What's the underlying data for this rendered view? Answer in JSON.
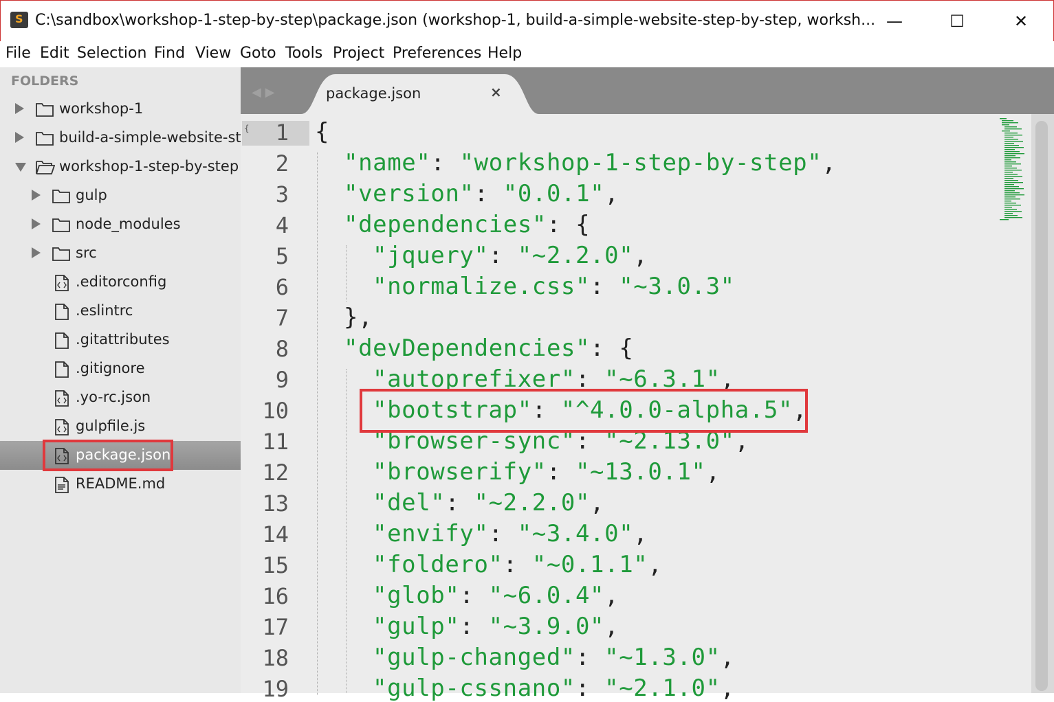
{
  "window": {
    "title": "C:\\sandbox\\workshop-1-step-by-step\\package.json (workshop-1, build-a-simple-website-step-by-step, worksh...",
    "minimize": "—",
    "maximize": "☐",
    "close": "✕"
  },
  "menu": [
    "File",
    "Edit",
    "Selection",
    "Find",
    "View",
    "Goto",
    "Tools",
    "Project",
    "Preferences",
    "Help"
  ],
  "sidebar": {
    "header": "FOLDERS",
    "items": [
      {
        "label": "workshop-1",
        "type": "folder",
        "depth": 0,
        "arrow": "closed"
      },
      {
        "label": "build-a-simple-website-ste",
        "type": "folder",
        "depth": 0,
        "arrow": "closed"
      },
      {
        "label": "workshop-1-step-by-step",
        "type": "folder-open",
        "depth": 0,
        "arrow": "open"
      },
      {
        "label": "gulp",
        "type": "folder",
        "depth": 1,
        "arrow": "closed"
      },
      {
        "label": "node_modules",
        "type": "folder",
        "depth": 1,
        "arrow": "closed"
      },
      {
        "label": "src",
        "type": "folder",
        "depth": 1,
        "arrow": "closed"
      },
      {
        "label": ".editorconfig",
        "type": "code-file",
        "depth": 1
      },
      {
        "label": ".eslintrc",
        "type": "file",
        "depth": 1
      },
      {
        "label": ".gitattributes",
        "type": "file",
        "depth": 1
      },
      {
        "label": ".gitignore",
        "type": "file",
        "depth": 1
      },
      {
        "label": ".yo-rc.json",
        "type": "code-file",
        "depth": 1
      },
      {
        "label": "gulpfile.js",
        "type": "code-file",
        "depth": 1
      },
      {
        "label": "package.json",
        "type": "code-file",
        "depth": 1,
        "selected": true
      },
      {
        "label": "README.md",
        "type": "text-file",
        "depth": 1
      }
    ]
  },
  "tab": {
    "label": "package.json",
    "close": "×"
  },
  "editor": {
    "lines": [
      {
        "n": "1",
        "indent": 0,
        "parts": [
          [
            "p",
            "{"
          ]
        ]
      },
      {
        "n": "2",
        "indent": 1,
        "parts": [
          [
            "s",
            "\"name\""
          ],
          [
            "p",
            ": "
          ],
          [
            "s",
            "\"workshop-1-step-by-step\""
          ],
          [
            "p",
            ","
          ]
        ]
      },
      {
        "n": "3",
        "indent": 1,
        "parts": [
          [
            "s",
            "\"version\""
          ],
          [
            "p",
            ": "
          ],
          [
            "s",
            "\"0.0.1\""
          ],
          [
            "p",
            ","
          ]
        ]
      },
      {
        "n": "4",
        "indent": 1,
        "parts": [
          [
            "s",
            "\"dependencies\""
          ],
          [
            "p",
            ": {"
          ]
        ]
      },
      {
        "n": "5",
        "indent": 2,
        "parts": [
          [
            "s",
            "\"jquery\""
          ],
          [
            "p",
            ": "
          ],
          [
            "s",
            "\"~2.2.0\""
          ],
          [
            "p",
            ","
          ]
        ]
      },
      {
        "n": "6",
        "indent": 2,
        "parts": [
          [
            "s",
            "\"normalize.css\""
          ],
          [
            "p",
            ": "
          ],
          [
            "s",
            "\"~3.0.3\""
          ]
        ]
      },
      {
        "n": "7",
        "indent": 1,
        "parts": [
          [
            "p",
            "},"
          ]
        ]
      },
      {
        "n": "8",
        "indent": 1,
        "parts": [
          [
            "s",
            "\"devDependencies\""
          ],
          [
            "p",
            ": {"
          ]
        ]
      },
      {
        "n": "9",
        "indent": 2,
        "parts": [
          [
            "s",
            "\"autoprefixer\""
          ],
          [
            "p",
            ": "
          ],
          [
            "s",
            "\"~6.3.1\""
          ],
          [
            "p",
            ","
          ]
        ]
      },
      {
        "n": "10",
        "indent": 2,
        "parts": [
          [
            "s",
            "\"bootstrap\""
          ],
          [
            "p",
            ": "
          ],
          [
            "s",
            "\"^4.0.0-alpha.5\""
          ],
          [
            "p",
            ","
          ]
        ]
      },
      {
        "n": "11",
        "indent": 2,
        "parts": [
          [
            "s",
            "\"browser-sync\""
          ],
          [
            "p",
            ": "
          ],
          [
            "s",
            "\"~2.13.0\""
          ],
          [
            "p",
            ","
          ]
        ]
      },
      {
        "n": "12",
        "indent": 2,
        "parts": [
          [
            "s",
            "\"browserify\""
          ],
          [
            "p",
            ": "
          ],
          [
            "s",
            "\"~13.0.1\""
          ],
          [
            "p",
            ","
          ]
        ]
      },
      {
        "n": "13",
        "indent": 2,
        "parts": [
          [
            "s",
            "\"del\""
          ],
          [
            "p",
            ": "
          ],
          [
            "s",
            "\"~2.2.0\""
          ],
          [
            "p",
            ","
          ]
        ]
      },
      {
        "n": "14",
        "indent": 2,
        "parts": [
          [
            "s",
            "\"envify\""
          ],
          [
            "p",
            ": "
          ],
          [
            "s",
            "\"~3.4.0\""
          ],
          [
            "p",
            ","
          ]
        ]
      },
      {
        "n": "15",
        "indent": 2,
        "parts": [
          [
            "s",
            "\"foldero\""
          ],
          [
            "p",
            ": "
          ],
          [
            "s",
            "\"~0.1.1\""
          ],
          [
            "p",
            ","
          ]
        ]
      },
      {
        "n": "16",
        "indent": 2,
        "parts": [
          [
            "s",
            "\"glob\""
          ],
          [
            "p",
            ": "
          ],
          [
            "s",
            "\"~6.0.4\""
          ],
          [
            "p",
            ","
          ]
        ]
      },
      {
        "n": "17",
        "indent": 2,
        "parts": [
          [
            "s",
            "\"gulp\""
          ],
          [
            "p",
            ": "
          ],
          [
            "s",
            "\"~3.9.0\""
          ],
          [
            "p",
            ","
          ]
        ]
      },
      {
        "n": "18",
        "indent": 2,
        "parts": [
          [
            "s",
            "\"gulp-changed\""
          ],
          [
            "p",
            ": "
          ],
          [
            "s",
            "\"~1.3.0\""
          ],
          [
            "p",
            ","
          ]
        ]
      },
      {
        "n": "19",
        "indent": 2,
        "parts": [
          [
            "s",
            "\"gulp-cssnano\""
          ],
          [
            "p",
            ": "
          ],
          [
            "s",
            "\"~2.1.0\""
          ],
          [
            "p",
            ","
          ]
        ]
      }
    ],
    "fold_marker": "{"
  },
  "colors": {
    "string": "#1f9a3a",
    "punct": "#222222",
    "highlight": "#e0393d",
    "selected_row": "#9a9a9a"
  }
}
